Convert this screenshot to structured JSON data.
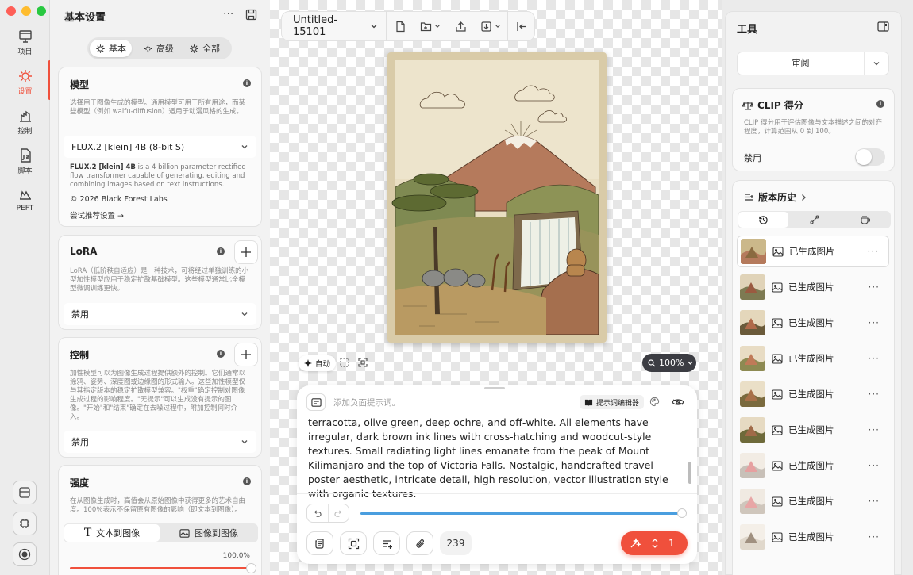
{
  "window": {
    "traffic_lights": [
      "#fe5f57",
      "#febc2e",
      "#28c840"
    ]
  },
  "rail": {
    "items": [
      {
        "label": "项目",
        "icon": "project-icon"
      },
      {
        "label": "设置",
        "icon": "settings-sun-icon",
        "active": true
      },
      {
        "label": "控制",
        "icon": "control-icon"
      },
      {
        "label": "脚本",
        "icon": "script-icon"
      },
      {
        "label": "PEFT",
        "icon": "peft-icon"
      }
    ]
  },
  "settings": {
    "title": "基本设置",
    "tabs": [
      "基本",
      "高级",
      "全部"
    ],
    "model": {
      "heading": "模型",
      "description": "选择用于图像生成的模型。通用模型可用于所有用途，而某些模型（例如 waifu-diffusion）适用于动漫风格的生成。",
      "selected": "FLUX.2 [klein] 4B (8-bit S)",
      "info_name": "FLUX.2 [klein] 4B",
      "info_text": " is a 4 billion parameter rectified flow transformer capable of generating, editing and combining images based on text instructions.",
      "copyright": "© 2026 Black Forest Labs",
      "try_link": "尝试推荐设置 →"
    },
    "lora": {
      "heading": "LoRA",
      "description": "LoRA（低阶秩自适应）是一种技术，可将经过单独训练的小型加性模型应用于稳定扩散基础模型。这些模型通常比全模型微调训练更快。",
      "selected": "禁用"
    },
    "control": {
      "heading": "控制",
      "description": "加性模型可以为图像生成过程提供额外的控制。它们通常以涂鸦、姿势、深度图或边缘图的形式输入。这些加性模型仅与其指定版本的稳定扩散模型兼容。\"权重\"确定控制对图像生成过程的影响程度。\"无提示\"可以生成没有提示的图像。\"开始\"和\"结束\"确定在去噪过程中，附加控制何时介入。",
      "selected": "禁用"
    },
    "strength": {
      "heading": "强度",
      "description": "在从图像生成时，高值会从原始图像中获得更多的艺术自由度。100％表示不保留原有图像的影响（即文本到图像）。",
      "mode_text": "文本到图像",
      "mode_image": "图像到图像",
      "value_label": "100.0%",
      "value": 1.0
    }
  },
  "canvas": {
    "doc_title": "Untitled-15101",
    "auto_label": "自动",
    "zoom": "100%"
  },
  "prompt": {
    "negative_placeholder": "添加负面提示词。",
    "editor_label": "提示词编辑器",
    "text": "terracotta, olive green, deep ochre, and off-white. All elements have irregular, dark brown ink lines with cross-hatching and woodcut-style textures. Small radiating light lines emanate from the peak of Mount Kilimanjaro and the top of Victoria Falls. Nostalgic, handcrafted travel poster aesthetic, intricate detail, high resolution, vector illustration style with organic textures.",
    "token_count": "239",
    "generate_count": "1",
    "progress": 0.99
  },
  "tools": {
    "title": "工具",
    "review_label": "审阅",
    "clip": {
      "heading": "CLIP 得分",
      "description": "CLIP 得分用于评估图像与文本描述之间的对齐程度，计算范围从 0 到 100。",
      "toggle_label": "禁用"
    },
    "history": {
      "heading": "版本历史",
      "items": [
        {
          "label": "已生成图片",
          "selected": true
        },
        {
          "label": "已生成图片"
        },
        {
          "label": "已生成图片"
        },
        {
          "label": "已生成图片"
        },
        {
          "label": "已生成图片"
        },
        {
          "label": "已生成图片"
        },
        {
          "label": "已生成图片"
        },
        {
          "label": "已生成图片"
        },
        {
          "label": "已生成图片"
        }
      ]
    }
  },
  "colors": {
    "accent": "#f0503c",
    "progress": "#4a9edf",
    "generate": "#f0503c",
    "zoom_pill": "#3c3d43"
  }
}
